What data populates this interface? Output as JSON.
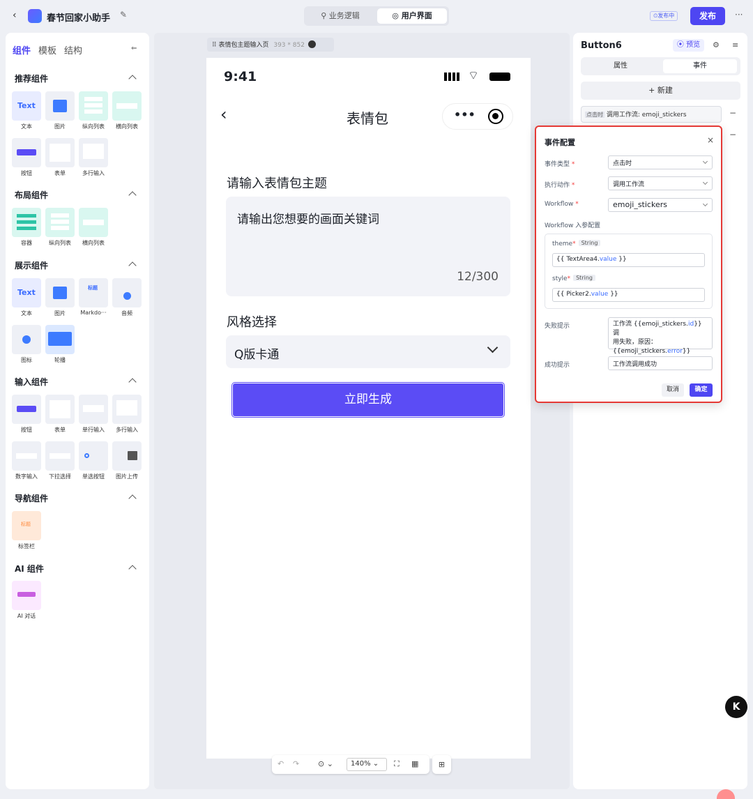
{
  "app": {
    "title": "春节回家小助手",
    "publishing": "发布中",
    "publish": "发布",
    "more": "···"
  },
  "mode_tabs": [
    {
      "label": "业务逻辑"
    },
    {
      "label": "用户界面"
    }
  ],
  "left": {
    "tabs": [
      "组件",
      "模板",
      "结构"
    ],
    "sections": {
      "recommend": "推荐组件",
      "layout": "布局组件",
      "display": "展示组件",
      "input": "输入组件",
      "nav": "导航组件",
      "ai": "AI 组件"
    },
    "labels": {
      "text": "文本",
      "image": "图片",
      "vlist": "纵向列表",
      "hlist": "横向列表",
      "button": "按钮",
      "form": "表单",
      "multiinput": "多行输入",
      "container": "容器",
      "markdown": "Markdo···",
      "audio": "音频",
      "icon": "图标",
      "carousel": "轮播",
      "singleinput": "单行输入",
      "numinput": "数字输入",
      "dropdown": "下拉选择",
      "radio": "单选按钮",
      "upload": "图片上传",
      "tabbar": "标签栏",
      "aichat": "AI 对话"
    },
    "tile_text": "Text",
    "tile_title": "标题"
  },
  "canvas": {
    "page_name": "表情包主题输入页",
    "page_size": "393 * 852",
    "time": "9:41",
    "title": "表情包",
    "q1": "请输入表情包主题",
    "textarea": "请输出您想要的画面关键词",
    "count": "12/300",
    "q2": "风格选择",
    "picker": "Q版卡通",
    "button": "立即生成",
    "zoom": "140%"
  },
  "right": {
    "component": "Button6",
    "preview": "预览",
    "tabs": [
      "属性",
      "事件"
    ],
    "add": "+ 新建",
    "event_tag": "点击时",
    "event_text": "调用工作流: emoji_stickers"
  },
  "dialog": {
    "title": "事件配置",
    "event_type_label": "事件类型",
    "event_type": "点击时",
    "action_label": "执行动作",
    "action": "调用工作流",
    "workflow_label": "Workflow",
    "workflow": "emoji_stickers",
    "params_label": "Workflow 入参配置",
    "theme": "theme",
    "style": "style",
    "type": "String",
    "theme_open": "{{ ",
    "theme_obj": "TextArea4.",
    "theme_prop": "value",
    "theme_close": " }}",
    "style_open": "{{ ",
    "style_obj": "Picker2.",
    "style_prop": "value",
    "style_close": " }}",
    "fail_label": "失败提示",
    "fail_1": "工作流 {{emoji_stickers.",
    "fail_1b": "id",
    "fail_1c": "}} 调",
    "fail_2": "用失败，原因：",
    "fail_3": "{{emoji_stickers.",
    "fail_3b": "error",
    "fail_3c": "}}",
    "success_label": "成功提示",
    "success": "工作流调用成功",
    "cancel": "取消",
    "confirm": "确定"
  },
  "colors": {
    "primary": "#5b4cf5",
    "highlight": "#e53935"
  }
}
